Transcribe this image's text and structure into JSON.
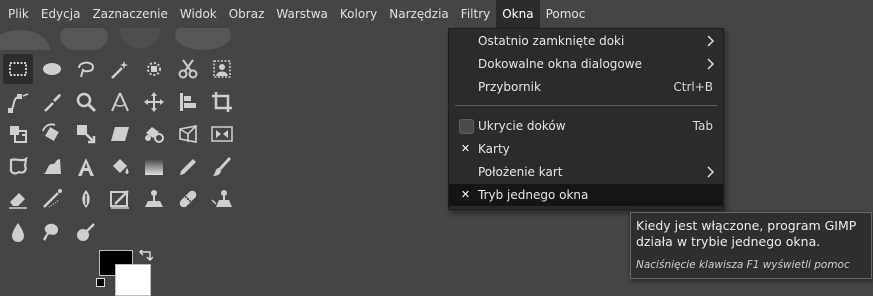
{
  "menubar": {
    "items": [
      "Plik",
      "Edycja",
      "Zaznaczenie",
      "Widok",
      "Obraz",
      "Warstwa",
      "Kolory",
      "Narzędzia",
      "Filtry",
      "Okna",
      "Pomoc"
    ],
    "active_index": 9
  },
  "okna_menu": {
    "items": [
      {
        "label": "Ostatnio zamknięte doki",
        "submenu": true
      },
      {
        "label": "Dokowalne okna dialogowe",
        "submenu": true
      },
      {
        "label": "Przybornik",
        "accel": "Ctrl+B"
      },
      {
        "label": "Ukrycie doków",
        "accel": "Tab",
        "checkbox": "unchecked"
      },
      {
        "label": "Karty",
        "checkbox": "checked"
      },
      {
        "label": "Położenie kart",
        "submenu": true
      },
      {
        "label": "Tryb jednego okna",
        "checkbox": "checked",
        "highlighted": true
      }
    ]
  },
  "tooltip": {
    "text": "Kiedy jest włączone, program GIMP działa w trybie jednego okna.",
    "hint": "Naciśnięcie klawisza F1 wyświetli pomoc"
  },
  "toolbox": {
    "tools": [
      "rect-select-icon",
      "ellipse-select-icon",
      "free-select-icon",
      "fuzzy-select-icon",
      "select-by-color-icon",
      "scissors-select-icon",
      "foreground-select-icon",
      "paths-icon",
      "color-picker-icon",
      "magnify-icon",
      "measure-icon",
      "move-icon",
      "align-icon",
      "crop-icon",
      "unified-transform-icon",
      "rotate-icon",
      "scale-icon",
      "shear-icon",
      "flip-icon",
      "perspective-icon",
      "flip-horizontal-icon",
      "cage-transform-icon",
      "warp-transform-icon",
      "text-icon",
      "bucket-fill-icon",
      "gradient-icon",
      "pencil-icon",
      "paintbrush-icon",
      "eraser-icon",
      "airbrush-icon",
      "ink-icon",
      "mypaint-brush-icon",
      "clone-icon",
      "heal-icon",
      "perspective-clone-icon",
      "blur-icon",
      "smudge-icon",
      "dodge-burn-icon"
    ],
    "selected_index": 0
  },
  "colors": {
    "foreground": "#000000",
    "background": "#ffffff",
    "menu_bg": "#2b2b2b",
    "window_bg": "#454545",
    "highlight": "#151515"
  }
}
